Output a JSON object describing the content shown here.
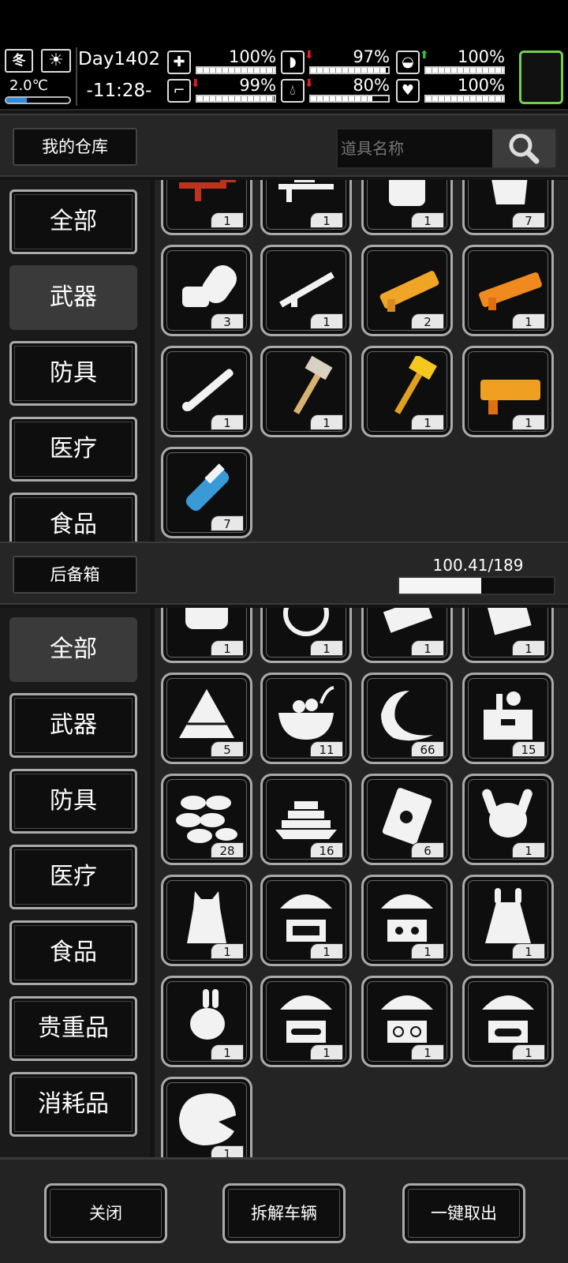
{
  "hud": {
    "season": "冬",
    "temperature": "2.0℃",
    "temperature_fill": 0.32,
    "day": "Day1402",
    "time": "-11:28-",
    "stats": [
      {
        "name": "health",
        "value": "100%",
        "fill": 1.0,
        "arrow": ""
      },
      {
        "name": "hunger",
        "value": "97%",
        "fill": 0.97,
        "arrow": "down"
      },
      {
        "name": "bladder",
        "value": "100%",
        "fill": 1.0,
        "arrow": "up"
      },
      {
        "name": "stamina",
        "value": "99%",
        "fill": 0.99,
        "arrow": "down"
      },
      {
        "name": "thirst",
        "value": "80%",
        "fill": 0.8,
        "arrow": "down"
      },
      {
        "name": "mood",
        "value": "100%",
        "fill": 1.0,
        "arrow": ""
      }
    ]
  },
  "warehouse": {
    "title": "我的仓库",
    "search_placeholder": "道具名称",
    "categories": [
      "全部",
      "武器",
      "防具",
      "医疗",
      "食品"
    ],
    "selected_category": "武器",
    "items": [
      {
        "icon": "rifle-red-icon",
        "count": "1"
      },
      {
        "icon": "sniper-rifle-icon",
        "count": "1"
      },
      {
        "icon": "armor-vest-icon",
        "count": "1"
      },
      {
        "icon": "shield-plate-icon",
        "count": "7"
      },
      {
        "icon": "chainsaw-icon",
        "count": "3"
      },
      {
        "icon": "assault-rifle-icon",
        "count": "1"
      },
      {
        "icon": "gold-shotgun-icon",
        "count": "2"
      },
      {
        "icon": "orange-shotgun-icon",
        "count": "1"
      },
      {
        "icon": "rocket-launcher-icon",
        "count": "1"
      },
      {
        "icon": "war-hammer-icon",
        "count": "1"
      },
      {
        "icon": "gold-hammer-icon",
        "count": "1"
      },
      {
        "icon": "gold-blaster-icon",
        "count": "1"
      },
      {
        "icon": "minigun-icon",
        "count": "7"
      }
    ]
  },
  "trunk": {
    "title": "后备箱",
    "weight": "100.41/189 kg",
    "weight_fill": 0.531,
    "categories": [
      "全部",
      "武器",
      "防具",
      "医疗",
      "食品",
      "贵重品",
      "消耗品"
    ],
    "selected_category": "全部",
    "items": [
      {
        "icon": "bread-icon",
        "count": "1"
      },
      {
        "icon": "cake-icon",
        "count": "1"
      },
      {
        "icon": "snack-bar-icon",
        "count": "1"
      },
      {
        "icon": "box-icon",
        "count": "1"
      },
      {
        "icon": "rice-dumpling-icon",
        "count": "5"
      },
      {
        "icon": "soup-bowl-icon",
        "count": "11"
      },
      {
        "icon": "croissant-icon",
        "count": "66"
      },
      {
        "icon": "grocery-box-icon",
        "count": "15"
      },
      {
        "icon": "dumplings-icon",
        "count": "28"
      },
      {
        "icon": "gold-bars-icon",
        "count": "16"
      },
      {
        "icon": "seed-packet-icon",
        "count": "6"
      },
      {
        "icon": "bunny-hat-icon",
        "count": "1"
      },
      {
        "icon": "cat-costume-icon",
        "count": "1"
      },
      {
        "icon": "airdrop-car-icon",
        "count": "1"
      },
      {
        "icon": "airdrop-motorbike-icon",
        "count": "1"
      },
      {
        "icon": "bunny-coat-icon",
        "count": "1"
      },
      {
        "icon": "bunny-plush-icon",
        "count": "1"
      },
      {
        "icon": "airdrop-sportscar-icon",
        "count": "1"
      },
      {
        "icon": "airdrop-bicycle-icon",
        "count": "1"
      },
      {
        "icon": "airdrop-scooter-icon",
        "count": "1"
      },
      {
        "icon": "dinosaur-hat-icon",
        "count": "1"
      }
    ]
  },
  "actions": {
    "close": "关闭",
    "dismantle": "拆解车辆",
    "take_all": "一键取出"
  },
  "colors": {
    "accent_green": "#6fd14a",
    "temp_blue": "#2c8de0",
    "arrow_red": "#e02020",
    "arrow_green": "#31c43a"
  }
}
